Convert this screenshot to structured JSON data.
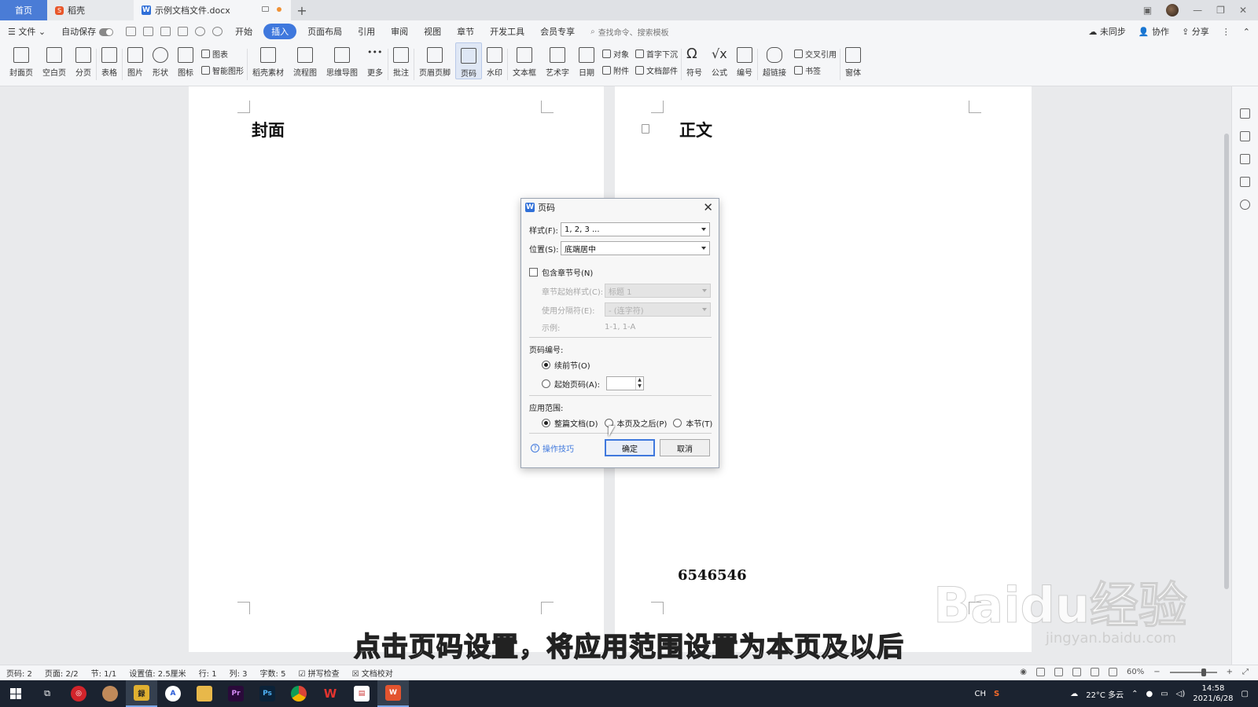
{
  "tabs": {
    "home": "首页",
    "daoke": "稻壳",
    "doc": "示例文档文件.docx",
    "add": "+"
  },
  "menu": {
    "file": "文件",
    "autosave": "自动保存",
    "items": [
      "开始",
      "插入",
      "页面布局",
      "引用",
      "审阅",
      "视图",
      "章节",
      "开发工具",
      "会员专享"
    ],
    "active_index": 1,
    "search": "查找命令、搜索模板",
    "unsynced": "未同步",
    "collab": "协作",
    "share": "分享"
  },
  "ribbon": {
    "cover": "封面页",
    "blank": "空白页",
    "break": "分页",
    "table": "表格",
    "picture": "图片",
    "shape": "形状",
    "icon": "图标",
    "chart": "图表",
    "smartart": "智能图形",
    "daoke_material": "稻壳素材",
    "flowchart": "流程图",
    "mindmap": "思维导图",
    "more": "更多",
    "comment": "批注",
    "header_footer": "页眉页脚",
    "page_number": "页码",
    "watermark": "水印",
    "textbox": "文本框",
    "wordart": "艺术字",
    "date": "日期",
    "object": "对象",
    "attachment": "附件",
    "dropcap": "首字下沉",
    "docparts": "文档部件",
    "symbol": "符号",
    "formula": "公式",
    "numbering": "编号",
    "hyperlink": "超链接",
    "crossref": "交叉引用",
    "bookmark": "书签",
    "window": "窗体"
  },
  "document": {
    "page1_heading": "封面",
    "page2_heading": "正文",
    "page_number_value": "6546546"
  },
  "dialog": {
    "title": "页码",
    "style_label": "样式(F):",
    "style_value": "1, 2, 3 ...",
    "position_label": "位置(S):",
    "position_value": "底端居中",
    "include_chapter": "包含章节号(N)",
    "chapter_start_label": "章节起始样式(C):",
    "chapter_start_value": "标题 1",
    "separator_label": "使用分隔符(E):",
    "separator_value": "-   (连字符)",
    "example_label": "示例:",
    "example_value": "1-1, 1-A",
    "numbering_heading": "页码编号:",
    "continue_prev": "续前节(O)",
    "start_at": "起始页码(A):",
    "apply_heading": "应用范围:",
    "apply_whole": "整篇文档(D)",
    "apply_after": "本页及之后(P)",
    "apply_section": "本节(T)",
    "tips": "操作技巧",
    "ok": "确定",
    "cancel": "取消"
  },
  "caption": "点击页码设置，将应用范围设置为本页及以后",
  "watermark_text": "Baidu经验",
  "watermark_sub": "jingyan.baidu.com",
  "status": {
    "page_num": "页码: 2",
    "page": "页面: 2/2",
    "section": "节: 1/1",
    "setting": "设置值: 2.5厘米",
    "row": "行: 1",
    "col": "列: 3",
    "words": "字数: 5",
    "spell": "拼写检查",
    "proof": "文档校对",
    "zoom": "60%"
  },
  "taskbar": {
    "weather": "22°C 多云",
    "time": "14:58",
    "date": "2021/6/28",
    "ime": "CH"
  }
}
